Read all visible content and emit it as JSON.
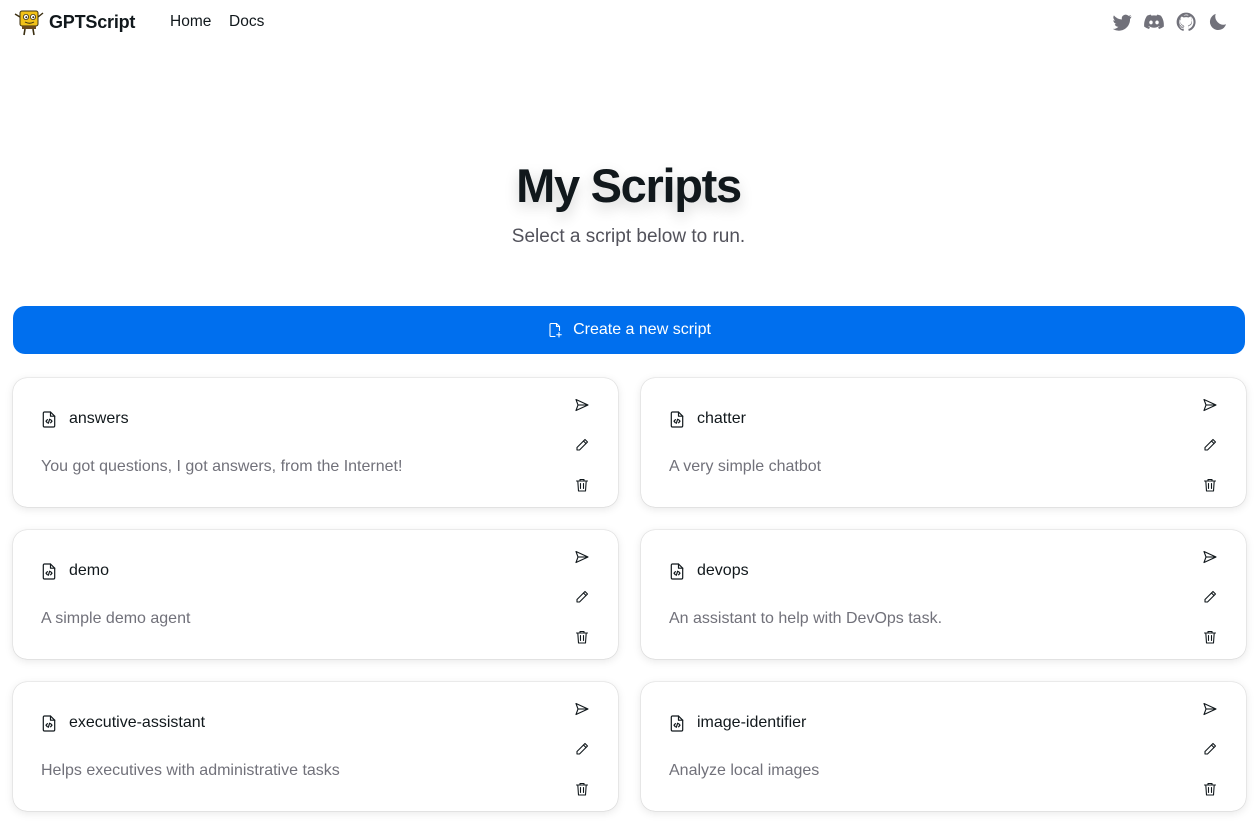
{
  "navbar": {
    "brand": "GPTScript",
    "links": [
      "Home",
      "Docs"
    ],
    "icons": [
      "twitter-icon",
      "discord-icon",
      "github-icon",
      "moon-icon"
    ]
  },
  "hero": {
    "title": "My Scripts",
    "subtitle": "Select a script below to run."
  },
  "create_button": {
    "label": "Create a new script",
    "icon": "file-plus-icon"
  },
  "scripts": [
    {
      "name": "answers",
      "description": "You got questions, I got answers, from the Internet!"
    },
    {
      "name": "chatter",
      "description": "A very simple chatbot"
    },
    {
      "name": "demo",
      "description": "A simple demo agent"
    },
    {
      "name": "devops",
      "description": "An assistant to help with DevOps task."
    },
    {
      "name": "executive-assistant",
      "description": "Helps executives with administrative tasks"
    },
    {
      "name": "image-identifier",
      "description": "Analyze local images"
    }
  ],
  "card_actions": [
    "send-icon",
    "pencil-icon",
    "trash-icon"
  ],
  "colors": {
    "primary": "#006fee",
    "text": "#11181c",
    "muted": "#71717a"
  }
}
